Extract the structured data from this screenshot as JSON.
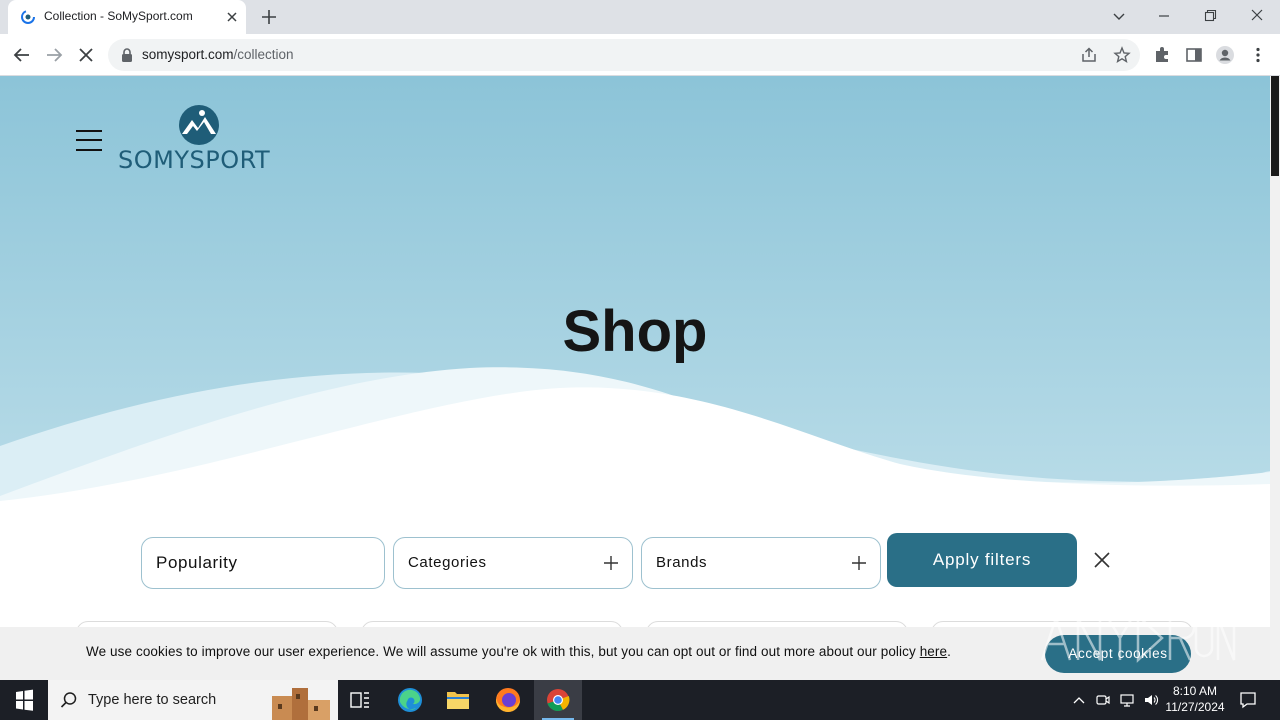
{
  "browser": {
    "tab_title": "Collection - SoMySport.com",
    "url_domain": "somysport.com",
    "url_path": "/collection"
  },
  "site": {
    "logo_text": "SOMYSPORT",
    "page_title": "Shop"
  },
  "filters": {
    "sort_label": "Popularity",
    "categories_label": "Categories",
    "brands_label": "Brands",
    "apply_label": "Apply filters"
  },
  "cookie": {
    "text": "We use cookies to improve our user experience. We will assume you're ok with this, but you can opt out or find out more about our policy ",
    "link_label": "here",
    "suffix": ".",
    "accept_label": "Accept cookies"
  },
  "taskbar": {
    "search_placeholder": "Type here to search",
    "time": "8:10 AM",
    "date": "11/27/2024"
  },
  "colors": {
    "hero_top": "#8cc4d8",
    "hero_bottom": "#b9dce8",
    "accent": "#2a6f87",
    "logo": "#1f5d78"
  }
}
